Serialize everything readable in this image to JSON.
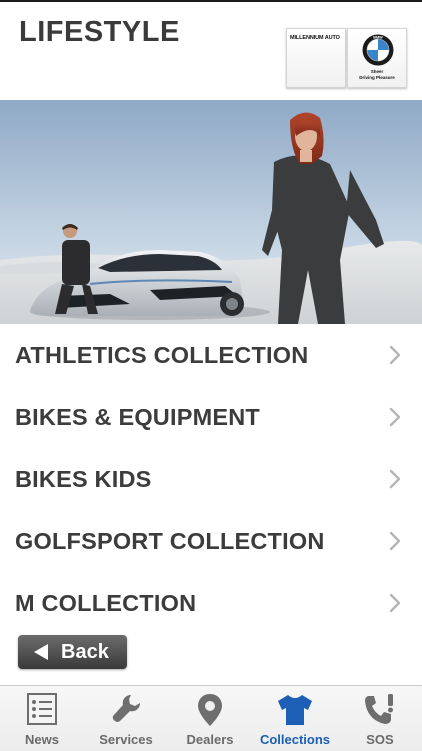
{
  "header": {
    "title": "LIFESTYLE",
    "dealer_logo_text": "MILLENNIUM AUTO",
    "brand_logo_letters": "BMW",
    "brand_tagline_1": "Sheer",
    "brand_tagline_2": "Driving Pleasure"
  },
  "hero": {
    "icon": "lifestyle-photo"
  },
  "collections": [
    {
      "label": "ATHLETICS COLLECTION"
    },
    {
      "label": "BIKES & EQUIPMENT"
    },
    {
      "label": "BIKES KIDS"
    },
    {
      "label": "GOLFSPORT COLLECTION"
    },
    {
      "label": "M COLLECTION"
    }
  ],
  "back_button": {
    "label": "Back"
  },
  "tabs": [
    {
      "label": "News",
      "icon": "news-icon"
    },
    {
      "label": "Services",
      "icon": "wrench-icon"
    },
    {
      "label": "Dealers",
      "icon": "map-pin-icon"
    },
    {
      "label": "Collections",
      "icon": "tshirt-icon",
      "active": true
    },
    {
      "label": "SOS",
      "icon": "phone-alert-icon"
    }
  ],
  "colors": {
    "active_tab": "#1c5fb5",
    "text": "#3c3c3c",
    "chevron": "#b5b5b5",
    "back_button": "#4a4a4a"
  }
}
